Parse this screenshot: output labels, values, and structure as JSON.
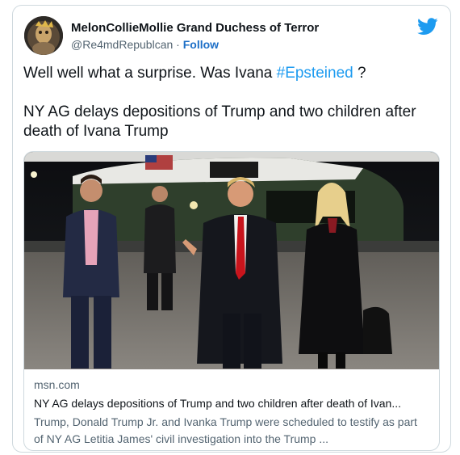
{
  "author": {
    "display_name": "MelonCollieMollie Grand Duchess of Terror",
    "handle": "@Re4mdRepublcan",
    "separator": "·",
    "follow_label": "Follow"
  },
  "tweet": {
    "text_before": "Well well what a surprise. Was Ivana ",
    "hashtag": "#Epsteined",
    "text_after": " ?\n\nNY AG delays depositions of Trump and two children after death of Ivana Trump"
  },
  "link_card": {
    "domain": "msn.com",
    "title": "NY AG delays depositions of Trump and two children after death of Ivan...",
    "description": "Trump, Donald Trump Jr. and Ivanka Trump were scheduled to testify as part of NY AG Letitia James' civil investigation into the Trump ..."
  },
  "icons": {
    "brand": "twitter-bird-icon",
    "brand_color": "#1d9bf0"
  },
  "colors": {
    "link_blue": "#1d9bf0",
    "follow_blue": "#1d6fc7",
    "muted_text": "#536471",
    "border": "#cfd9de"
  }
}
